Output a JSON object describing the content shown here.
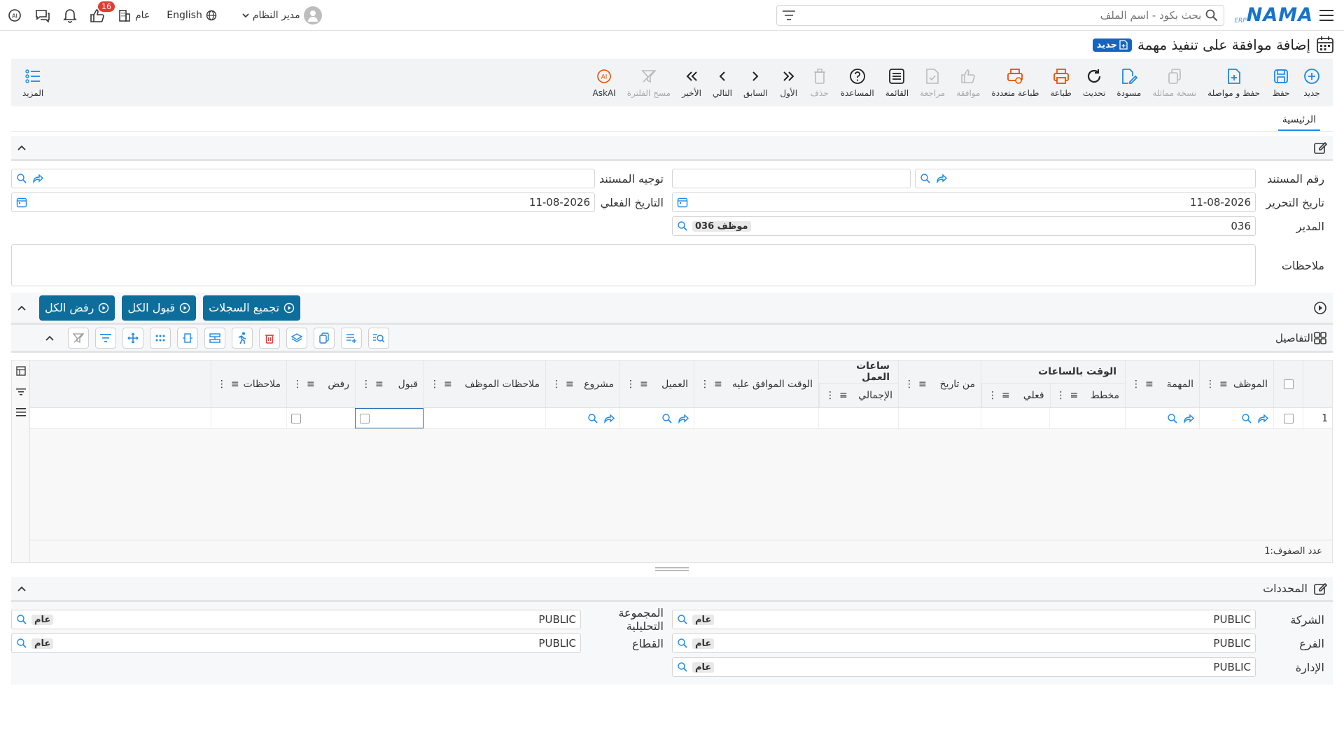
{
  "header": {
    "logo_text": "NAMA",
    "logo_sub": "ERP",
    "search_placeholder": "بحث بكود - اسم الملف",
    "language": "English",
    "branch": "عام",
    "notification_count": "16",
    "user": "مدير النظام"
  },
  "page": {
    "title": "إضافة موافقة على تنفيذ مهمة",
    "status_badge": "جديد"
  },
  "toolbar": {
    "buttons": [
      {
        "label": "جديد",
        "icon": "plus-circle-icon"
      },
      {
        "label": "حفظ",
        "icon": "save-icon"
      },
      {
        "label": "حفظ و مواصلة",
        "icon": "file-plus-icon"
      },
      {
        "label": "نسخة مماثلة",
        "icon": "copy-icon"
      },
      {
        "label": "مسودة",
        "icon": "draft-icon"
      },
      {
        "label": "تحديث",
        "icon": "refresh-icon"
      },
      {
        "label": "طباعة",
        "icon": "print-icon"
      },
      {
        "label": "طباعة متعددة",
        "icon": "multi-print-icon"
      },
      {
        "label": "موافقة",
        "icon": "thumbs-up-icon"
      },
      {
        "label": "مراجعة",
        "icon": "review-icon"
      },
      {
        "label": "القائمة",
        "icon": "list-icon"
      },
      {
        "label": "المساعدة",
        "icon": "help-icon"
      },
      {
        "label": "حذف",
        "icon": "trash-icon"
      },
      {
        "label": "الأول",
        "icon": "first-icon"
      },
      {
        "label": "السابق",
        "icon": "prev-icon"
      },
      {
        "label": "التالي",
        "icon": "next-icon"
      },
      {
        "label": "الأخير",
        "icon": "last-icon"
      },
      {
        "label": "مسح الفلترة",
        "icon": "clear-filter-icon"
      },
      {
        "label": "AskAI",
        "icon": "ai-icon"
      }
    ],
    "more_label": "المزيد"
  },
  "tabs": {
    "main": "الرئيسية"
  },
  "form": {
    "doc_number_label": "رقم المستند",
    "doc_direction_label": "توجيه المستند",
    "edit_date_label": "تاريخ التحرير",
    "edit_date_value": "11-08-2026",
    "actual_date_label": "التاريخ الفعلي",
    "actual_date_value": "11-08-2026",
    "manager_label": "المدير",
    "manager_code": "036",
    "manager_name": "موظف 036",
    "notes_label": "ملاحظات"
  },
  "actions": {
    "collect": "تجميع السجلات",
    "accept_all": "قبول الكل",
    "reject_all": "رفض الكل"
  },
  "details": {
    "title": "التفاصيل",
    "group_time": "الوقت بالساعات",
    "group_work": "ساعات العمل",
    "columns": {
      "employee": "الموظف",
      "task": "المهمة",
      "planned": "مخطط",
      "actual": "فعلي",
      "from_date": "من تاريخ",
      "total": "الإجمالي",
      "approved_time": "الوقت الموافق عليه",
      "client": "العميل",
      "project": "مشروع",
      "employee_notes": "ملاحظات الموظف",
      "accept": "قبول",
      "reject": "رفض",
      "notes": "ملاحظات"
    },
    "rows": [
      {
        "num": "1"
      }
    ],
    "row_count_label": "عدد الصفوف:",
    "row_count": "1"
  },
  "dimensions": {
    "title": "المحددات",
    "company_label": "الشركة",
    "company_value": "PUBLIC",
    "company_tag": "عام",
    "branch_label": "الفرع",
    "branch_value": "PUBLIC",
    "branch_tag": "عام",
    "dept_label": "الإدارة",
    "dept_value": "PUBLIC",
    "dept_tag": "عام",
    "analytic_label": "المجموعة التحليلية",
    "analytic_value": "PUBLIC",
    "analytic_tag": "عام",
    "sector_label": "القطاع",
    "sector_value": "PUBLIC",
    "sector_tag": "عام"
  },
  "colors": {
    "accent": "#1e88e5",
    "action": "#0d6e9c",
    "print": "#e65100"
  }
}
